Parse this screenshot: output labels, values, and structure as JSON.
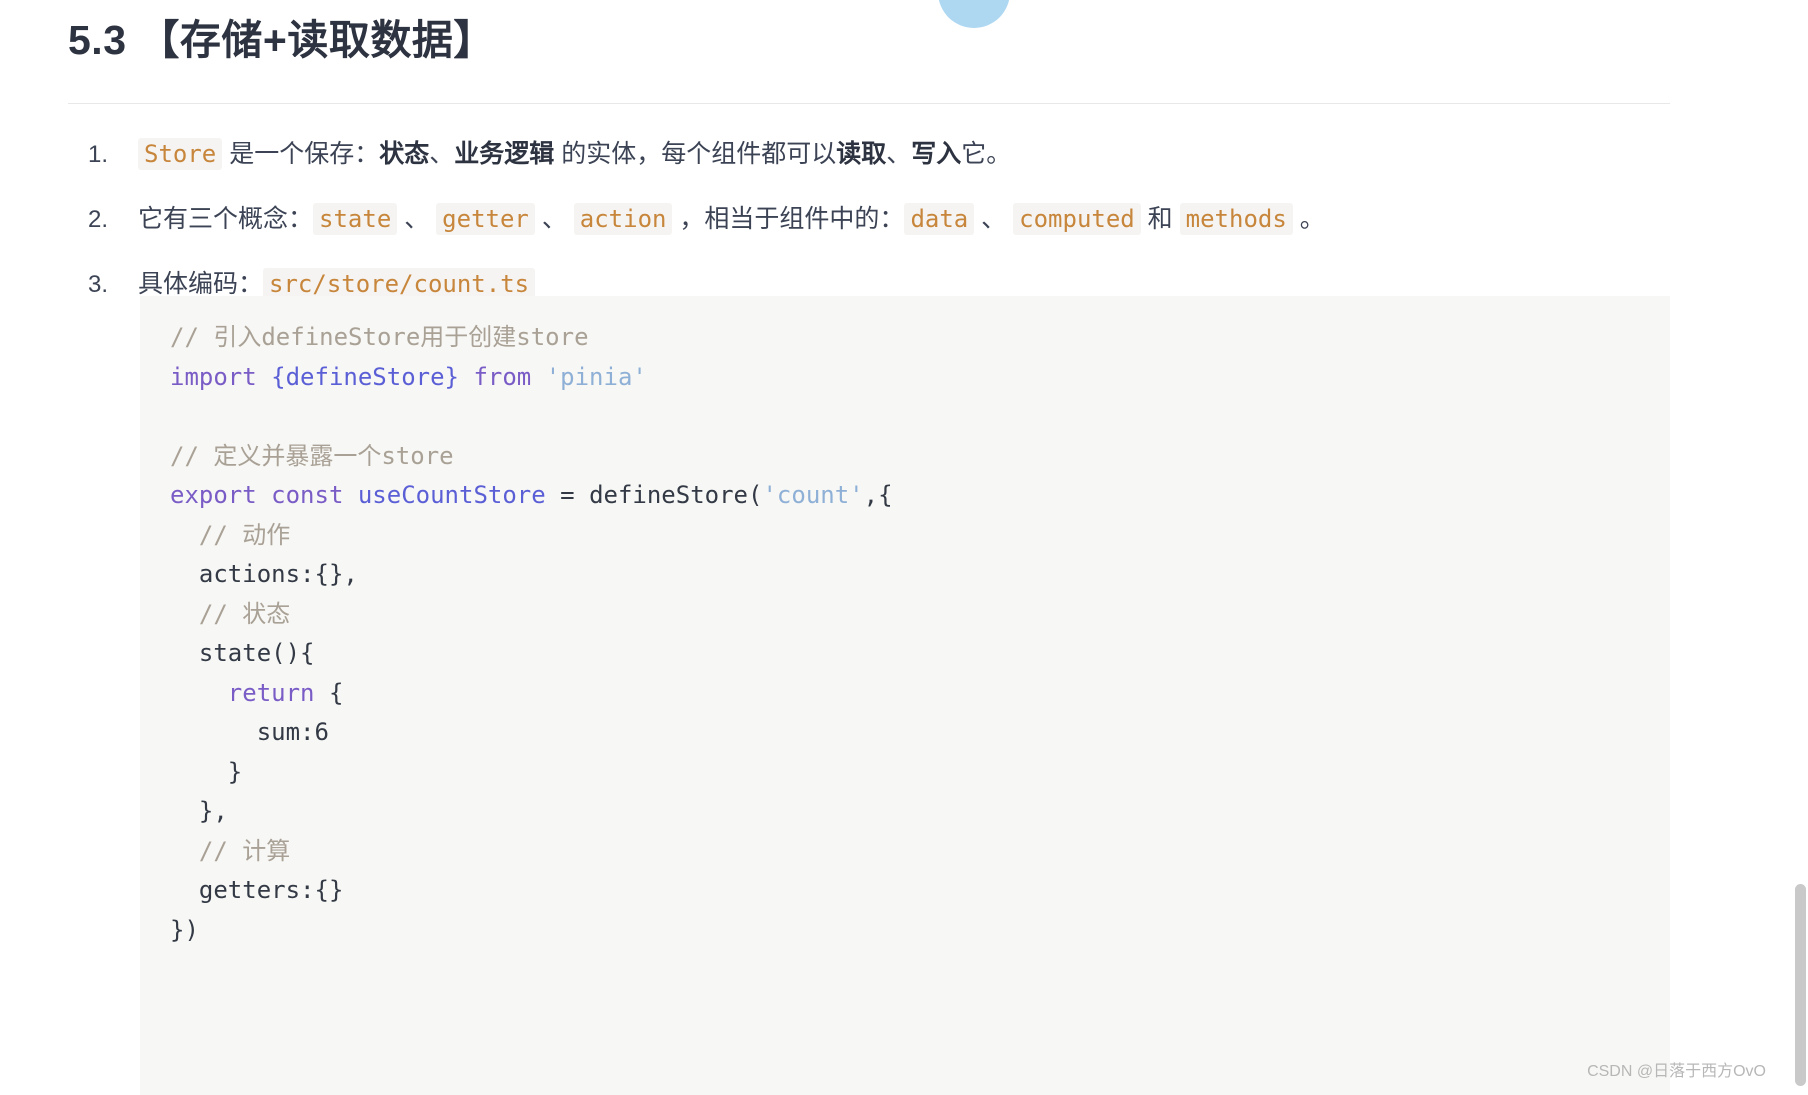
{
  "document": {
    "heading": "5.3 【存储+读取数据】",
    "list": [
      {
        "marker": "1.",
        "segments": [
          {
            "text": "Store",
            "style": "code"
          },
          {
            "text": " 是一个保存：",
            "style": "plain"
          },
          {
            "text": "状态",
            "style": "bold"
          },
          {
            "text": "、",
            "style": "plain"
          },
          {
            "text": "业务逻辑",
            "style": "bold"
          },
          {
            "text": " 的实体，每个组件都可以",
            "style": "plain"
          },
          {
            "text": "读取",
            "style": "bold"
          },
          {
            "text": "、",
            "style": "plain"
          },
          {
            "text": "写入",
            "style": "bold"
          },
          {
            "text": "它。",
            "style": "plain"
          }
        ]
      },
      {
        "marker": "2.",
        "segments": [
          {
            "text": "它有三个概念：",
            "style": "plain"
          },
          {
            "text": "state",
            "style": "code"
          },
          {
            "text": " 、 ",
            "style": "plain"
          },
          {
            "text": "getter",
            "style": "code"
          },
          {
            "text": " 、 ",
            "style": "plain"
          },
          {
            "text": "action",
            "style": "code"
          },
          {
            "text": " ，相当于组件中的：",
            "style": "plain"
          },
          {
            "text": "data",
            "style": "code"
          },
          {
            "text": " 、 ",
            "style": "plain"
          },
          {
            "text": "computed",
            "style": "code"
          },
          {
            "text": " 和 ",
            "style": "plain"
          },
          {
            "text": "methods",
            "style": "code"
          },
          {
            "text": " 。",
            "style": "plain"
          }
        ]
      },
      {
        "marker": "3.",
        "segments": [
          {
            "text": "具体编码：",
            "style": "plain"
          },
          {
            "text": "src/store/count.ts",
            "style": "code"
          }
        ]
      }
    ],
    "code_block": {
      "language": "typescript",
      "lines": [
        [
          {
            "t": "// 引入defineStore用于创建store",
            "c": "cm"
          }
        ],
        [
          {
            "t": "import",
            "c": "kw"
          },
          {
            "t": " ",
            "c": "pn"
          },
          {
            "t": "{defineStore}",
            "c": "id"
          },
          {
            "t": " ",
            "c": "pn"
          },
          {
            "t": "from",
            "c": "kw"
          },
          {
            "t": " ",
            "c": "pn"
          },
          {
            "t": "'pinia'",
            "c": "str"
          }
        ],
        [
          {
            "t": "",
            "c": "pn"
          }
        ],
        [
          {
            "t": "// 定义并暴露一个store",
            "c": "cm"
          }
        ],
        [
          {
            "t": "export",
            "c": "kw"
          },
          {
            "t": " ",
            "c": "pn"
          },
          {
            "t": "const",
            "c": "kw"
          },
          {
            "t": " ",
            "c": "pn"
          },
          {
            "t": "useCountStore",
            "c": "id"
          },
          {
            "t": " = ",
            "c": "pn"
          },
          {
            "t": "defineStore",
            "c": "pn"
          },
          {
            "t": "(",
            "c": "pn"
          },
          {
            "t": "'count'",
            "c": "str"
          },
          {
            "t": ",{",
            "c": "pn"
          }
        ],
        [
          {
            "t": "  // 动作",
            "c": "cm"
          }
        ],
        [
          {
            "t": "  actions:{},",
            "c": "pn"
          }
        ],
        [
          {
            "t": "  // 状态",
            "c": "cm"
          }
        ],
        [
          {
            "t": "  state(){",
            "c": "pn"
          }
        ],
        [
          {
            "t": "    return",
            "c": "kw"
          },
          {
            "t": " {",
            "c": "pn"
          }
        ],
        [
          {
            "t": "      sum:",
            "c": "pn"
          },
          {
            "t": "6",
            "c": "num"
          }
        ],
        [
          {
            "t": "    }",
            "c": "pn"
          }
        ],
        [
          {
            "t": "  },",
            "c": "pn"
          }
        ],
        [
          {
            "t": "  // 计算",
            "c": "cm"
          }
        ],
        [
          {
            "t": "  getters:{}",
            "c": "pn"
          }
        ],
        [
          {
            "t": "})",
            "c": "pn"
          }
        ]
      ]
    }
  },
  "watermark": "CSDN @日落于西方OvO",
  "colors": {
    "heading": "#2d3340",
    "inline_code": "#c7863b",
    "code_bg": "#f7f7f5",
    "comment": "#a9a195",
    "keyword": "#7a5cc6",
    "identifier": "#5b5fd6",
    "string": "#8fb0d6",
    "accent_circle": "#aed8f2"
  }
}
